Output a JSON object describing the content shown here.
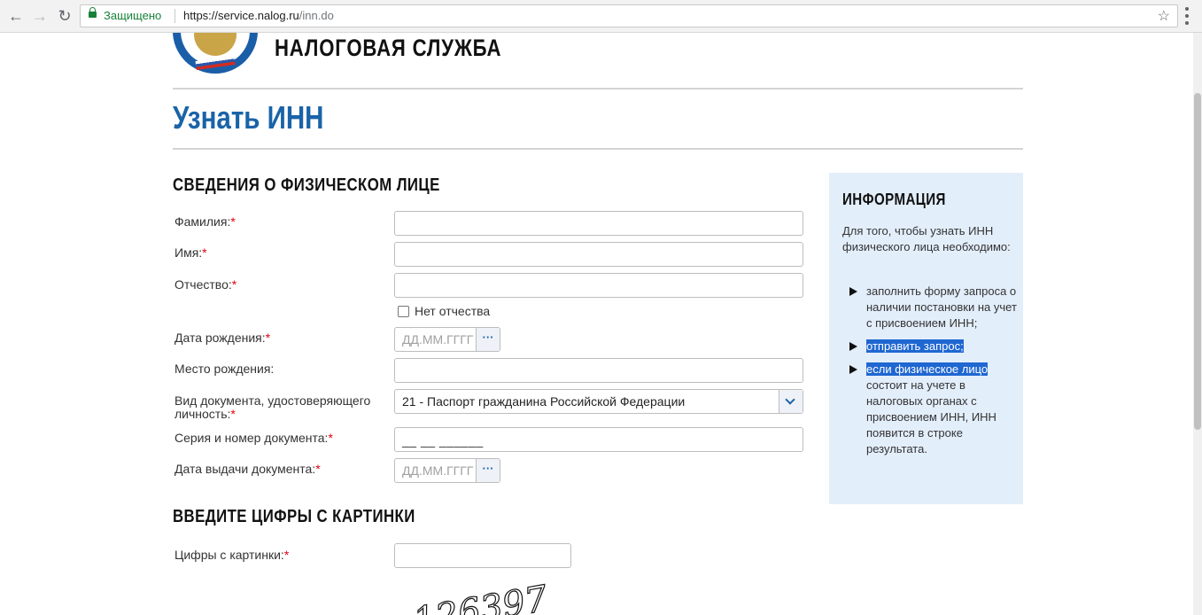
{
  "browser": {
    "secure_label": "Защищено",
    "url_host": "https://service.nalog.ru",
    "url_path": "/inn.do"
  },
  "header": {
    "brand": "НАЛОГОВАЯ СЛУЖБА",
    "page_title": "Узнать ИНН"
  },
  "form": {
    "section_person": "СВЕДЕНИЯ О ФИЗИЧЕСКОМ ЛИЦЕ",
    "required_mark": "*",
    "fields": {
      "surname": "Фамилия:",
      "name": "Имя:",
      "patronymic": "Отчество:",
      "no_patronymic": "Нет отчества",
      "birth_date": "Дата рождения:",
      "birth_place": "Место рождения:",
      "doc_type_line1": "Вид документа, удостоверяющего",
      "doc_type_line2": "личность:",
      "doc_number": "Серия и номер документа:",
      "issue_date": "Дата выдачи документа:"
    },
    "date_placeholder": "ДД.ММ.ГГГГ",
    "date_button": "···",
    "doc_type_value": "21 - Паспорт гражданина Российской Федерации",
    "doc_number_mask": "__ __ ______",
    "section_captcha": "ВВЕДИТЕ ЦИФРЫ С КАРТИНКИ",
    "captcha_label": "Цифры с картинки:",
    "captcha_image_text": "126397"
  },
  "info": {
    "title": "ИНФОРМАЦИЯ",
    "intro": "Для того, чтобы узнать ИНН физического лица необходимо:",
    "items": {
      "first": "заполнить форму запроса о наличии постановки на учет с присвоением ИНН;",
      "second": "отправить запрос;",
      "third_highlight": "если физическое лицо",
      "third_rest": " состоит на учете в налоговых органах с присвоением ИНН, ИНН появится в строке результата."
    }
  },
  "colors": {
    "brand_blue": "#1a63a8",
    "info_bg": "#e3eefb",
    "required_red": "#e0000d",
    "selection_blue": "#1f67d1"
  }
}
